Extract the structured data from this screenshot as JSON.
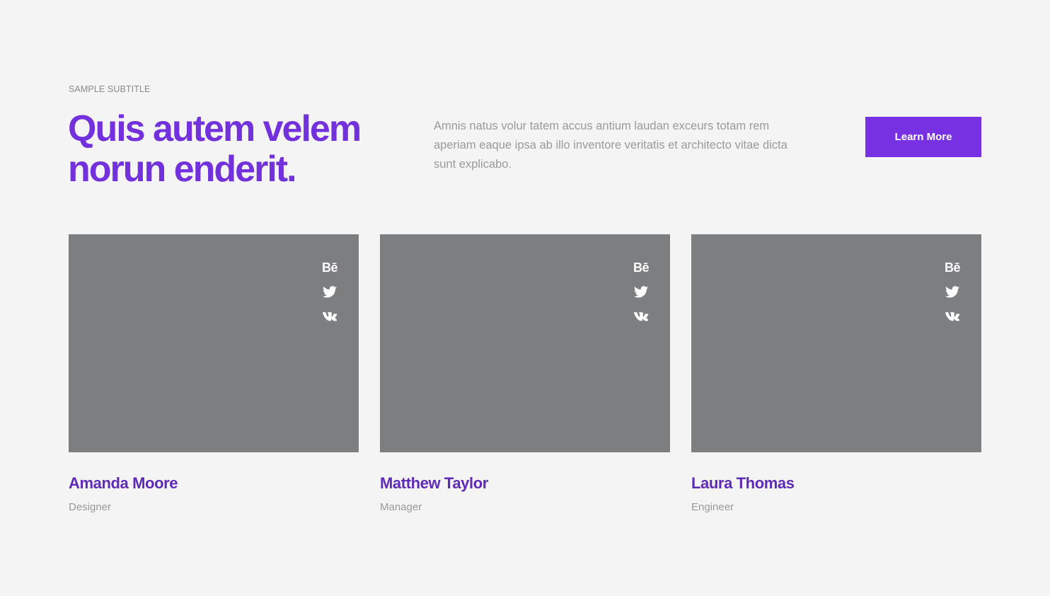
{
  "header": {
    "subtitle": "SAMPLE SUBTITLE",
    "title": "Quis autem velem norun enderit.",
    "description": "Amnis natus volur tatem accus antium laudan exceurs totam rem aperiam eaque ipsa ab illo inventore veritatis et architecto vitae dicta sunt explicabo.",
    "button_label": "Learn More"
  },
  "team": [
    {
      "name": "Amanda Moore",
      "role": "Designer"
    },
    {
      "name": "Matthew Taylor",
      "role": "Manager"
    },
    {
      "name": "Laura Thomas",
      "role": "Engineer"
    }
  ],
  "social_icons": {
    "behance": "Bē",
    "twitter": "twitter-icon",
    "vk": "vk-icon"
  },
  "colors": {
    "accent": "#7831e2",
    "title": "#7231dc",
    "name": "#5f2ab8",
    "photo_placeholder": "#7d7e80",
    "background": "#f4f4f4"
  }
}
